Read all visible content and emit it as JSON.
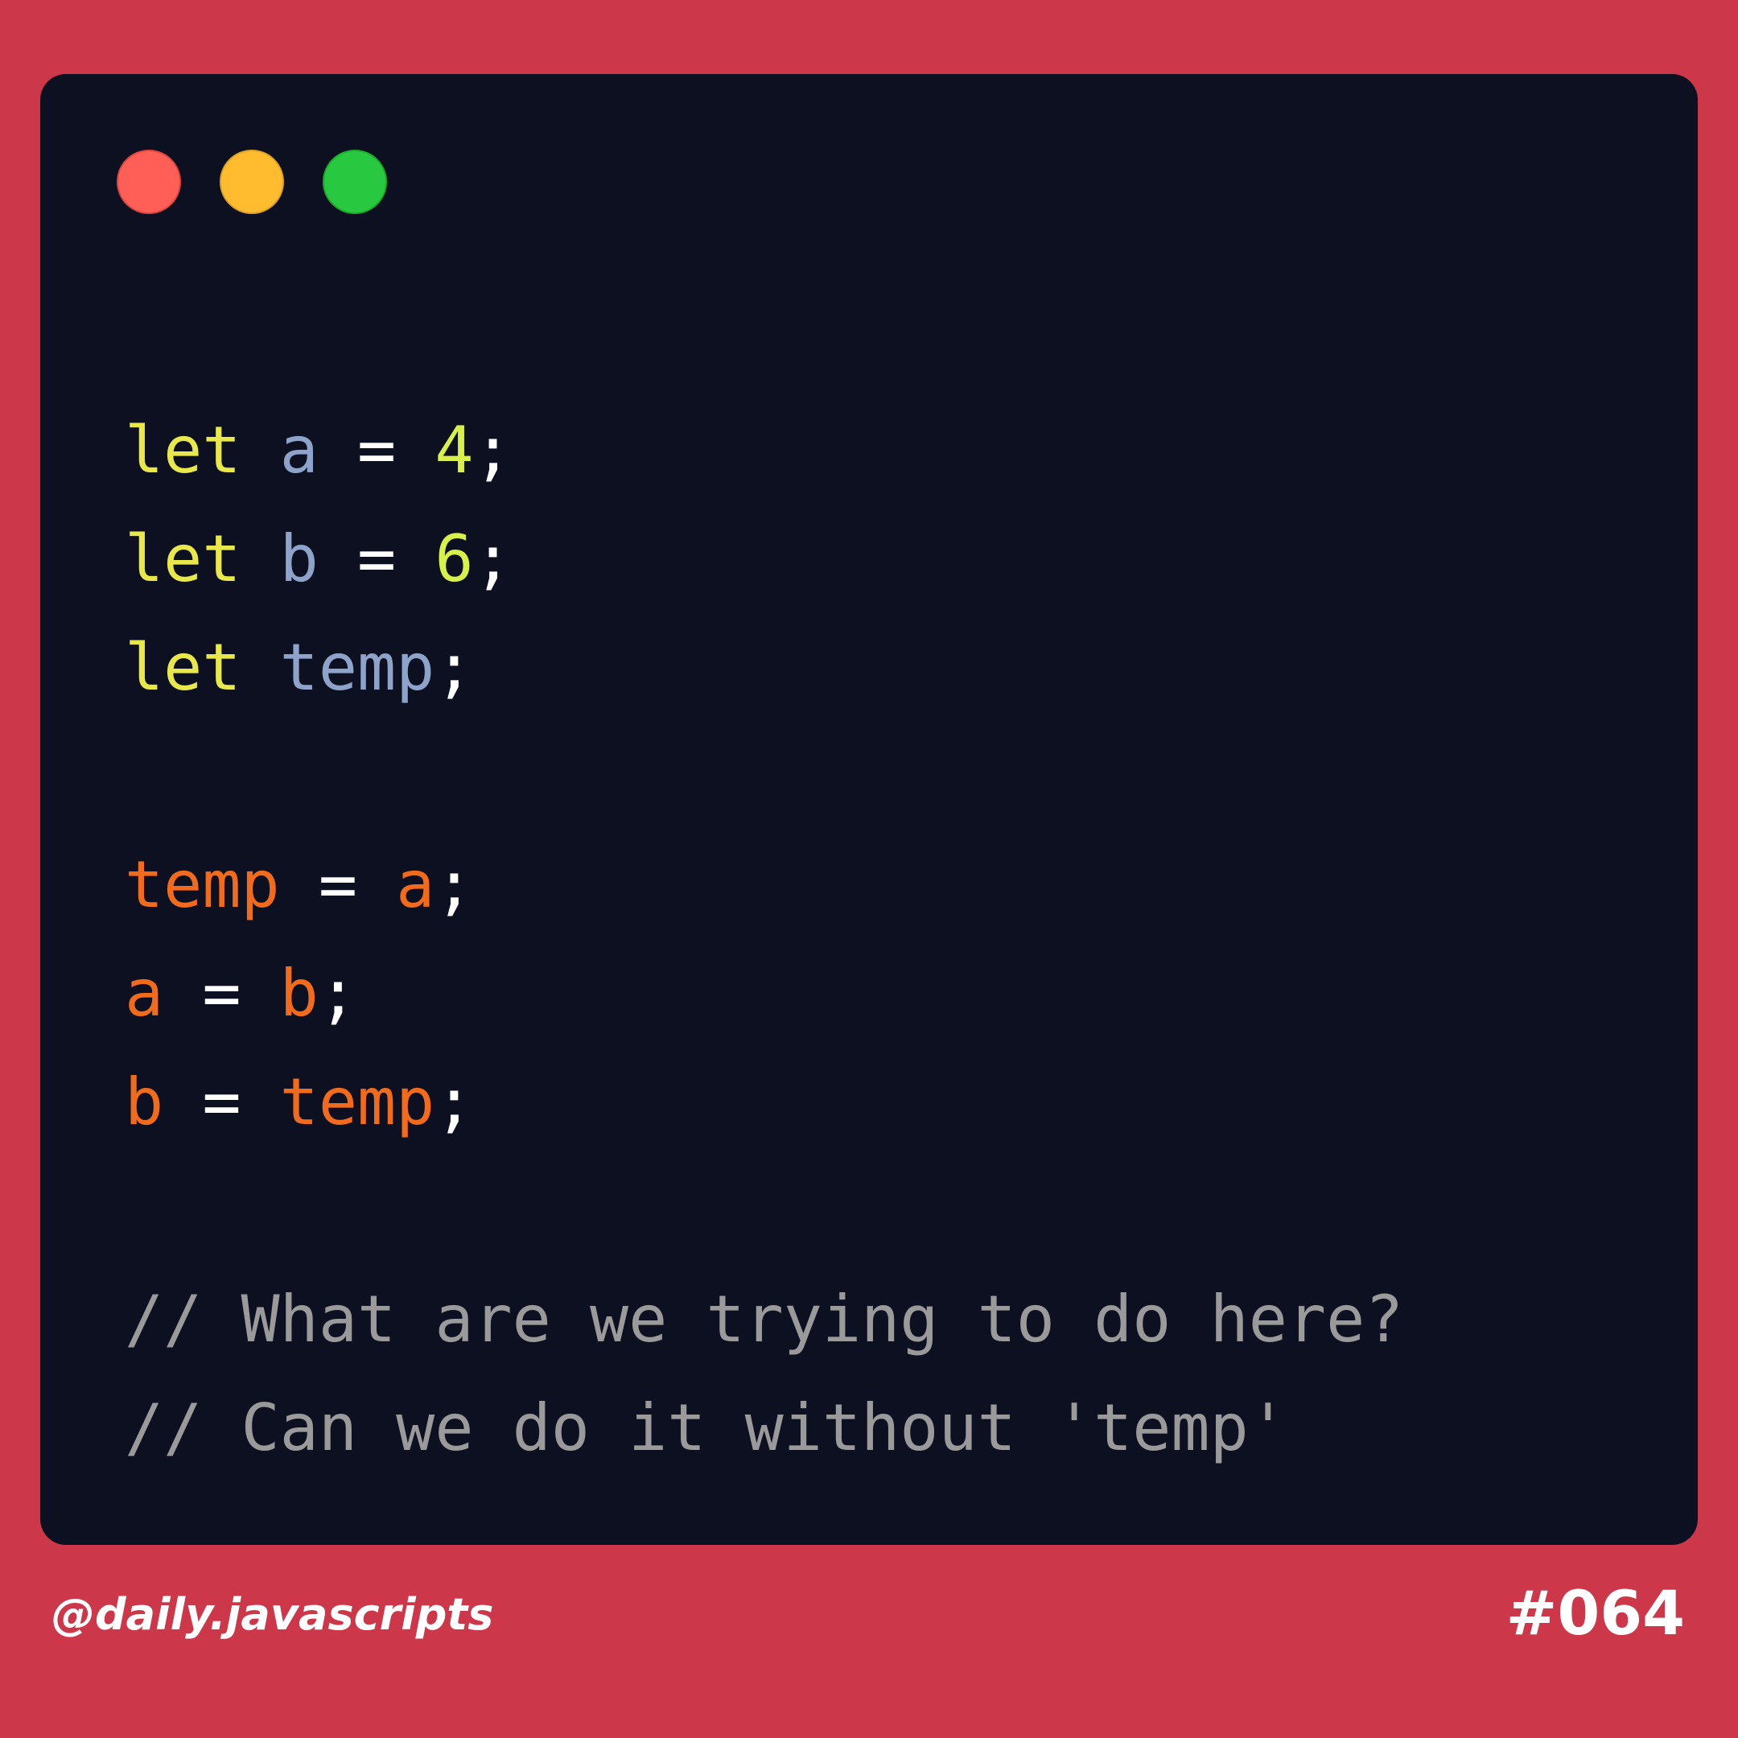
{
  "window": {
    "buttons": [
      {
        "name": "close",
        "color": "#ff5f57"
      },
      {
        "name": "minimize",
        "color": "#febc2e"
      },
      {
        "name": "maximize",
        "color": "#28c840"
      }
    ]
  },
  "code": {
    "lines": [
      [
        {
          "t": "let",
          "c": "kw"
        },
        {
          "t": " ",
          "c": "op"
        },
        {
          "t": "a",
          "c": "decl"
        },
        {
          "t": " = ",
          "c": "op"
        },
        {
          "t": "4",
          "c": "num"
        },
        {
          "t": ";",
          "c": "op"
        }
      ],
      [
        {
          "t": "let",
          "c": "kw"
        },
        {
          "t": " ",
          "c": "op"
        },
        {
          "t": "b",
          "c": "decl"
        },
        {
          "t": " = ",
          "c": "op"
        },
        {
          "t": "6",
          "c": "num"
        },
        {
          "t": ";",
          "c": "op"
        }
      ],
      [
        {
          "t": "let",
          "c": "kw"
        },
        {
          "t": " ",
          "c": "op"
        },
        {
          "t": "temp",
          "c": "decl"
        },
        {
          "t": ";",
          "c": "op"
        }
      ],
      [],
      [
        {
          "t": "temp",
          "c": "assign"
        },
        {
          "t": " = ",
          "c": "op"
        },
        {
          "t": "a",
          "c": "assign"
        },
        {
          "t": ";",
          "c": "op"
        }
      ],
      [
        {
          "t": "a",
          "c": "assign"
        },
        {
          "t": " = ",
          "c": "op"
        },
        {
          "t": "b",
          "c": "assign"
        },
        {
          "t": ";",
          "c": "op"
        }
      ],
      [
        {
          "t": "b",
          "c": "assign"
        },
        {
          "t": " = ",
          "c": "op"
        },
        {
          "t": "temp",
          "c": "assign"
        },
        {
          "t": ";",
          "c": "op"
        }
      ],
      [],
      [
        {
          "t": "// What are we trying to do here?",
          "c": "comment"
        }
      ],
      [
        {
          "t": "// Can we do it without 'temp'",
          "c": "comment"
        }
      ]
    ]
  },
  "footer": {
    "handle": "@daily.javascripts",
    "number": "#064"
  }
}
